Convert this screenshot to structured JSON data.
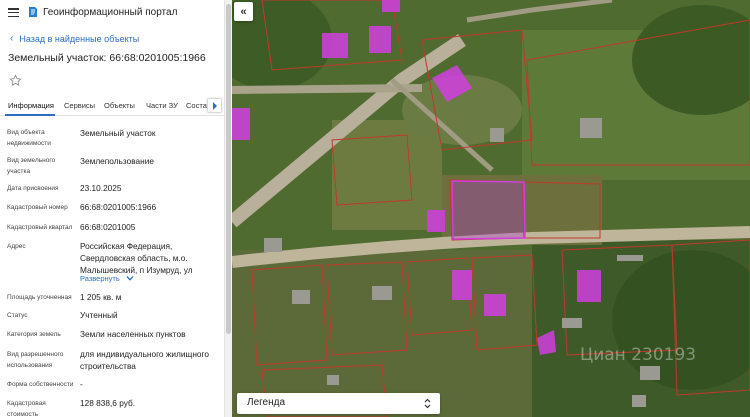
{
  "app": {
    "title": "Геоинформационный портал"
  },
  "nav": {
    "back_label": "Назад в найденные объекты"
  },
  "object": {
    "title": "Земельный участок: 66:68:0201005:1966"
  },
  "tabs": [
    {
      "label": "Информация"
    },
    {
      "label": "Сервисы"
    },
    {
      "label": "Объекты"
    },
    {
      "label": "Части ЗУ"
    },
    {
      "label": "Состав"
    }
  ],
  "fields": [
    {
      "label": "Вид объекта недвижимости",
      "value": "Земельный участок"
    },
    {
      "label": "Вид земельного участка",
      "value": "Землепользование"
    },
    {
      "label": "Дата присвоения",
      "value": "23.10.2025"
    },
    {
      "label": "Кадастровый номер",
      "value": "66:68:0201005:1966"
    },
    {
      "label": "Кадастровый квартал",
      "value": "66:68:0201005"
    },
    {
      "label": "Адрес",
      "value": "Российская Федерация, Свердловская область, м.о. Малышевский, п Изумруд, ул"
    },
    {
      "label": "Площадь уточненная",
      "value": "1 205 кв. м"
    },
    {
      "label": "Статус",
      "value": "Учтенный"
    },
    {
      "label": "Категория земель",
      "value": "Земли населенных пунктов"
    },
    {
      "label": "Вид разрешенного использования",
      "value": "для индивидуального жилищного строительства"
    },
    {
      "label": "Форма собственности",
      "value": "-"
    },
    {
      "label": "Кадастровая стоимость",
      "value": "128 838,6 руб."
    }
  ],
  "address_expand_label": "Развернуть",
  "map": {
    "legend_label": "Легенда",
    "watermark": "Циан 230193",
    "colors": {
      "parcel_border": "#c0392b",
      "building_fill": "#d13ee0",
      "selected_parcel": "#b03ad0"
    }
  }
}
